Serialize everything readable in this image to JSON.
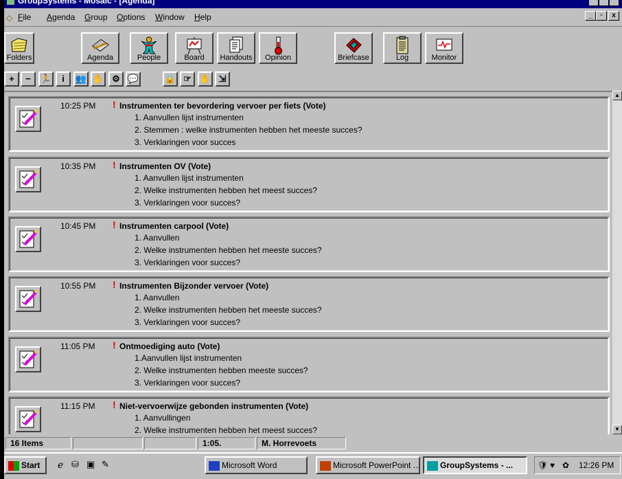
{
  "window": {
    "title": "GroupSystems - Mosaic - [Agenda]"
  },
  "menu": {
    "items": [
      {
        "label": "File",
        "ul": "F",
        "rest": "ile"
      },
      {
        "label": "Agenda",
        "ul": "A",
        "rest": "genda"
      },
      {
        "label": "Group",
        "ul": "G",
        "rest": "roup"
      },
      {
        "label": "Options",
        "ul": "O",
        "rest": "ptions"
      },
      {
        "label": "Window",
        "ul": "W",
        "rest": "indow"
      },
      {
        "label": "Help",
        "ul": "H",
        "rest": "elp"
      }
    ],
    "mdi_min": "_",
    "mdi_restore": "▫",
    "mdi_close": "x"
  },
  "toolbar": {
    "folders": "Folders",
    "agenda": "Agenda",
    "people": "People",
    "board": "Board",
    "handouts": "Handouts",
    "opinion": "Opinion",
    "briefcase": "Briefcase",
    "log": "Log",
    "monitor": "Monitor"
  },
  "toolbar2": {
    "add": "+",
    "remove": "−",
    "info": "i"
  },
  "agenda": {
    "items": [
      {
        "time": "10:25 PM",
        "title": "Instrumenten ter bevordering vervoer per fiets (Vote)",
        "subs": [
          "1. Aanvullen lijst instrumenten",
          "2. Stemmen : welke instrumenten hebben het meeste succes?",
          "3. Verklaringen voor succes"
        ]
      },
      {
        "time": "10:35 PM",
        "title": "Instrumenten OV (Vote)",
        "subs": [
          "1. Aanvullen lijst instrumenten",
          "2. Welke instrumenten hebben het meest succes?",
          "3. Verklaringen voor succes?"
        ]
      },
      {
        "time": "10:45 PM",
        "title": "Instrumenten carpool (Vote)",
        "subs": [
          "1. Aanvullen",
          "2. Welke instrumenten hebben het meeste succes?",
          "3. Verklaringen voor succes?"
        ]
      },
      {
        "time": "10:55 PM",
        "title": "Instrumenten Bijzonder vervoer (Vote)",
        "subs": [
          "1. Aanvullen",
          "2. Welke instrumenten hebben het meeste succes?",
          "3. Verklaringen voor succes?"
        ]
      },
      {
        "time": "11:05 PM",
        "title": "Ontmoediging auto (Vote)",
        "subs": [
          "1.Aanvullen lijst instrumenten",
          "2. Welke instrumenten hebben meeste succes?",
          "3. Verklaringen voor succes?"
        ]
      },
      {
        "time": "11:15 PM",
        "title": "Niet-vervoerwijze gebonden instrumenten (Vote)",
        "subs": [
          "1. Aanvullingen",
          "2. Welke instrumenten hebben het meest succes?",
          ""
        ]
      }
    ]
  },
  "status": {
    "count": "16 Items",
    "time": "1:05.",
    "user": "M. Horrevoets"
  },
  "taskbar": {
    "start": "Start",
    "tasks": [
      "Microsoft Word",
      "Microsoft PowerPoint ...",
      "GroupSystems - ..."
    ],
    "clock": "12:26 PM"
  },
  "colors": {
    "titlebar": "#000080",
    "chrome": "#c0c0c0",
    "mark": "#e00000"
  }
}
